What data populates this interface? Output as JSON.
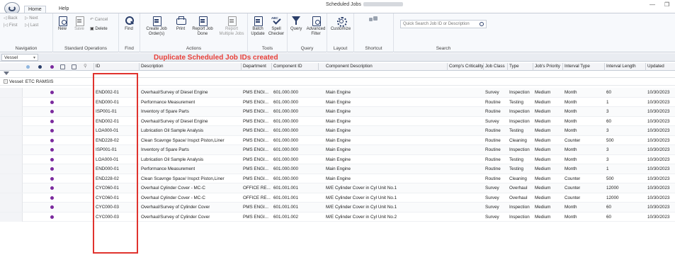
{
  "window": {
    "title": "Scheduled Jobs",
    "minimize": "—",
    "restore": "❐"
  },
  "tabs": [
    {
      "label": "Home"
    },
    {
      "label": "Help"
    }
  ],
  "ribbon": {
    "navigation": {
      "back": "◁ Back",
      "next": "▷ Next",
      "first": "|◁ First",
      "last": "▷| Last",
      "label": "Navigation"
    },
    "standard": {
      "new": "New",
      "save": "Save",
      "cancel": "↶ Cancel",
      "delete": "Delete",
      "label": "Standard Operations"
    },
    "find": {
      "find": "Find",
      "label": "Find"
    },
    "actions": {
      "create": "Create Job Order(s)",
      "print": "Print",
      "report_done": "Report Job Done",
      "report_multiple": "Report Multiple Jobs",
      "label": "Actions"
    },
    "tools": {
      "batch": "Batch Update",
      "spell": "Spell Checker",
      "label": "Tools"
    },
    "query": {
      "query": "Query",
      "advanced": "Advanced Filter",
      "label": "Query"
    },
    "layout": {
      "customize": "Customize",
      "label": "Layout"
    },
    "shortcut": {
      "label": "Shortcut"
    },
    "search": {
      "placeholder": "Quick Search Job ID or Description",
      "label": "Search"
    }
  },
  "toolbar": {
    "vessel_dropdown": "Vessel",
    "annotation": "Duplicate Scheduled Job IDs created"
  },
  "columns": [
    "ID",
    "Description",
    "Department",
    "Component ID",
    "Component Description",
    "Comp's Criticality",
    "Job Class",
    "Type",
    "Job's Priority",
    "Interval Type",
    "Interval Length",
    "Updated"
  ],
  "group": {
    "label": "Vessel: ETC RAMSIS"
  },
  "rows": [
    {
      "id": "END002-01",
      "desc": "Overhaul/Survey of Diesel Engine",
      "dept": "PMS ENGI...",
      "comp_id": "601.000.000",
      "comp_desc": "Main Engine",
      "class": "Survey",
      "type": "Inspection",
      "priority": "Medium",
      "itype": "Month",
      "ilen": "60",
      "updated": "10/30/2023"
    },
    {
      "id": "END000-01",
      "desc": "Performance Measurement",
      "dept": "PMS ENGI...",
      "comp_id": "601.000.000",
      "comp_desc": "Main Engine",
      "class": "Routine",
      "type": "Testing",
      "priority": "Medium",
      "itype": "Month",
      "ilen": "1",
      "updated": "10/30/2023"
    },
    {
      "id": "ISP001-01",
      "desc": "Inventory of Spare Parts",
      "dept": "PMS ENGI...",
      "comp_id": "601.000.000",
      "comp_desc": "Main Engine",
      "class": "Routine",
      "type": "Inspection",
      "priority": "Medium",
      "itype": "Month",
      "ilen": "3",
      "updated": "10/30/2023"
    },
    {
      "id": "END002-01",
      "desc": "Overhaul/Survey of Diesel Engine",
      "dept": "PMS ENGI...",
      "comp_id": "601.000.000",
      "comp_desc": "Main Engine",
      "class": "Survey",
      "type": "Inspection",
      "priority": "Medium",
      "itype": "Month",
      "ilen": "60",
      "updated": "10/30/2023"
    },
    {
      "id": "LOA000-01",
      "desc": "Lubrication Oil Sample Analysis",
      "dept": "PMS ENGI...",
      "comp_id": "601.000.000",
      "comp_desc": "Main Engine",
      "class": "Routine",
      "type": "Testing",
      "priority": "Medium",
      "itype": "Month",
      "ilen": "3",
      "updated": "10/30/2023"
    },
    {
      "id": "END228-02",
      "desc": "Clean Scavnge Space/ Inspct Piston,Liner",
      "dept": "PMS ENGI...",
      "comp_id": "601.000.000",
      "comp_desc": "Main Engine",
      "class": "Routine",
      "type": "Cleaning",
      "priority": "Medium",
      "itype": "Counter",
      "ilen": "500",
      "updated": "10/30/2023"
    },
    {
      "id": "ISP001-01",
      "desc": "Inventory of Spare Parts",
      "dept": "PMS ENGI...",
      "comp_id": "601.000.000",
      "comp_desc": "Main Engine",
      "class": "Routine",
      "type": "Inspection",
      "priority": "Medium",
      "itype": "Month",
      "ilen": "3",
      "updated": "10/30/2023"
    },
    {
      "id": "LOA000-01",
      "desc": "Lubrication Oil Sample Analysis",
      "dept": "PMS ENGI...",
      "comp_id": "601.000.000",
      "comp_desc": "Main Engine",
      "class": "Routine",
      "type": "Testing",
      "priority": "Medium",
      "itype": "Month",
      "ilen": "3",
      "updated": "10/30/2023"
    },
    {
      "id": "END000-01",
      "desc": "Performance Measurement",
      "dept": "PMS ENGI...",
      "comp_id": "601.000.000",
      "comp_desc": "Main Engine",
      "class": "Routine",
      "type": "Testing",
      "priority": "Medium",
      "itype": "Month",
      "ilen": "1",
      "updated": "10/30/2023"
    },
    {
      "id": "END228-02",
      "desc": "Clean Scavnge Space/ Inspct Piston,Liner",
      "dept": "PMS ENGI...",
      "comp_id": "601.000.000",
      "comp_desc": "Main Engine",
      "class": "Routine",
      "type": "Cleaning",
      "priority": "Medium",
      "itype": "Counter",
      "ilen": "500",
      "updated": "10/30/2023"
    },
    {
      "id": "CYC060-01",
      "desc": "Overhaul Cylinder Cover - MC-C",
      "dept": "OFFICE RE...",
      "comp_id": "601.001.001",
      "comp_desc": "M/E Cylinder Cover in Cyl Unit No.1",
      "class": "Survey",
      "type": "Overhaul",
      "priority": "Medium",
      "itype": "Counter",
      "ilen": "12000",
      "updated": "10/30/2023"
    },
    {
      "id": "CYC060-01",
      "desc": "Overhaul Cylinder Cover - MC-C",
      "dept": "OFFICE RE...",
      "comp_id": "601.001.001",
      "comp_desc": "M/E Cylinder Cover in Cyl Unit No.1",
      "class": "Survey",
      "type": "Overhaul",
      "priority": "Medium",
      "itype": "Counter",
      "ilen": "12000",
      "updated": "10/30/2023"
    },
    {
      "id": "CYC000-03",
      "desc": "Overhaul/Survey of Cylinder Cover",
      "dept": "PMS ENGI...",
      "comp_id": "601.001.001",
      "comp_desc": "M/E Cylinder Cover in Cyl Unit No.1",
      "class": "Survey",
      "type": "Inspection",
      "priority": "Medium",
      "itype": "Month",
      "ilen": "60",
      "updated": "10/30/2023"
    },
    {
      "id": "CYC000-03",
      "desc": "Overhaul/Survey of Cylinder Cover",
      "dept": "PMS ENGI...",
      "comp_id": "601.001.002",
      "comp_desc": "M/E Cylinder Cover in Cyl Unit No.2",
      "class": "Survey",
      "type": "Inspection",
      "priority": "Medium",
      "itype": "Month",
      "ilen": "60",
      "updated": "10/30/2023"
    }
  ],
  "colors": {
    "accent": "#2a3e6a",
    "annotation": "#e8403a",
    "dot_purple": "#7b2a9e"
  }
}
